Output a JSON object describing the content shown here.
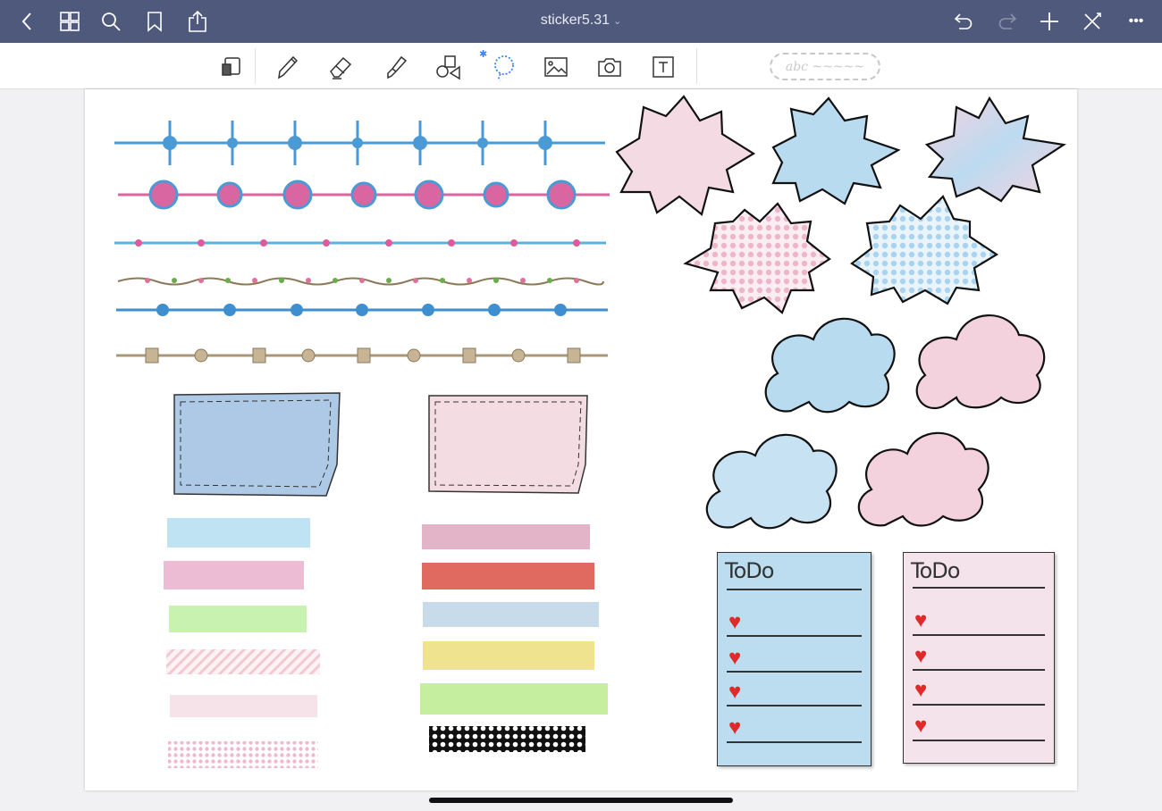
{
  "header": {
    "title": "sticker5.31",
    "icons": [
      "back-icon",
      "grid-icon",
      "search-icon",
      "bookmark-icon",
      "share-icon",
      "undo-icon",
      "redo-icon",
      "add-icon",
      "close-tools-icon",
      "more-icon"
    ]
  },
  "toolbar": {
    "tools": [
      "lasso-eraser",
      "pen",
      "eraser",
      "highlighter",
      "shapes",
      "lasso",
      "image",
      "camera",
      "text"
    ],
    "active_tool": "lasso",
    "pen_preview": "abc ~~~~~",
    "accent": "#3c82f0"
  },
  "todo_cards": [
    {
      "title": "ToDo",
      "color": "#bcdcf0",
      "items": 4
    },
    {
      "title": "ToDo",
      "color": "#f4e3eb",
      "items": 4
    }
  ]
}
